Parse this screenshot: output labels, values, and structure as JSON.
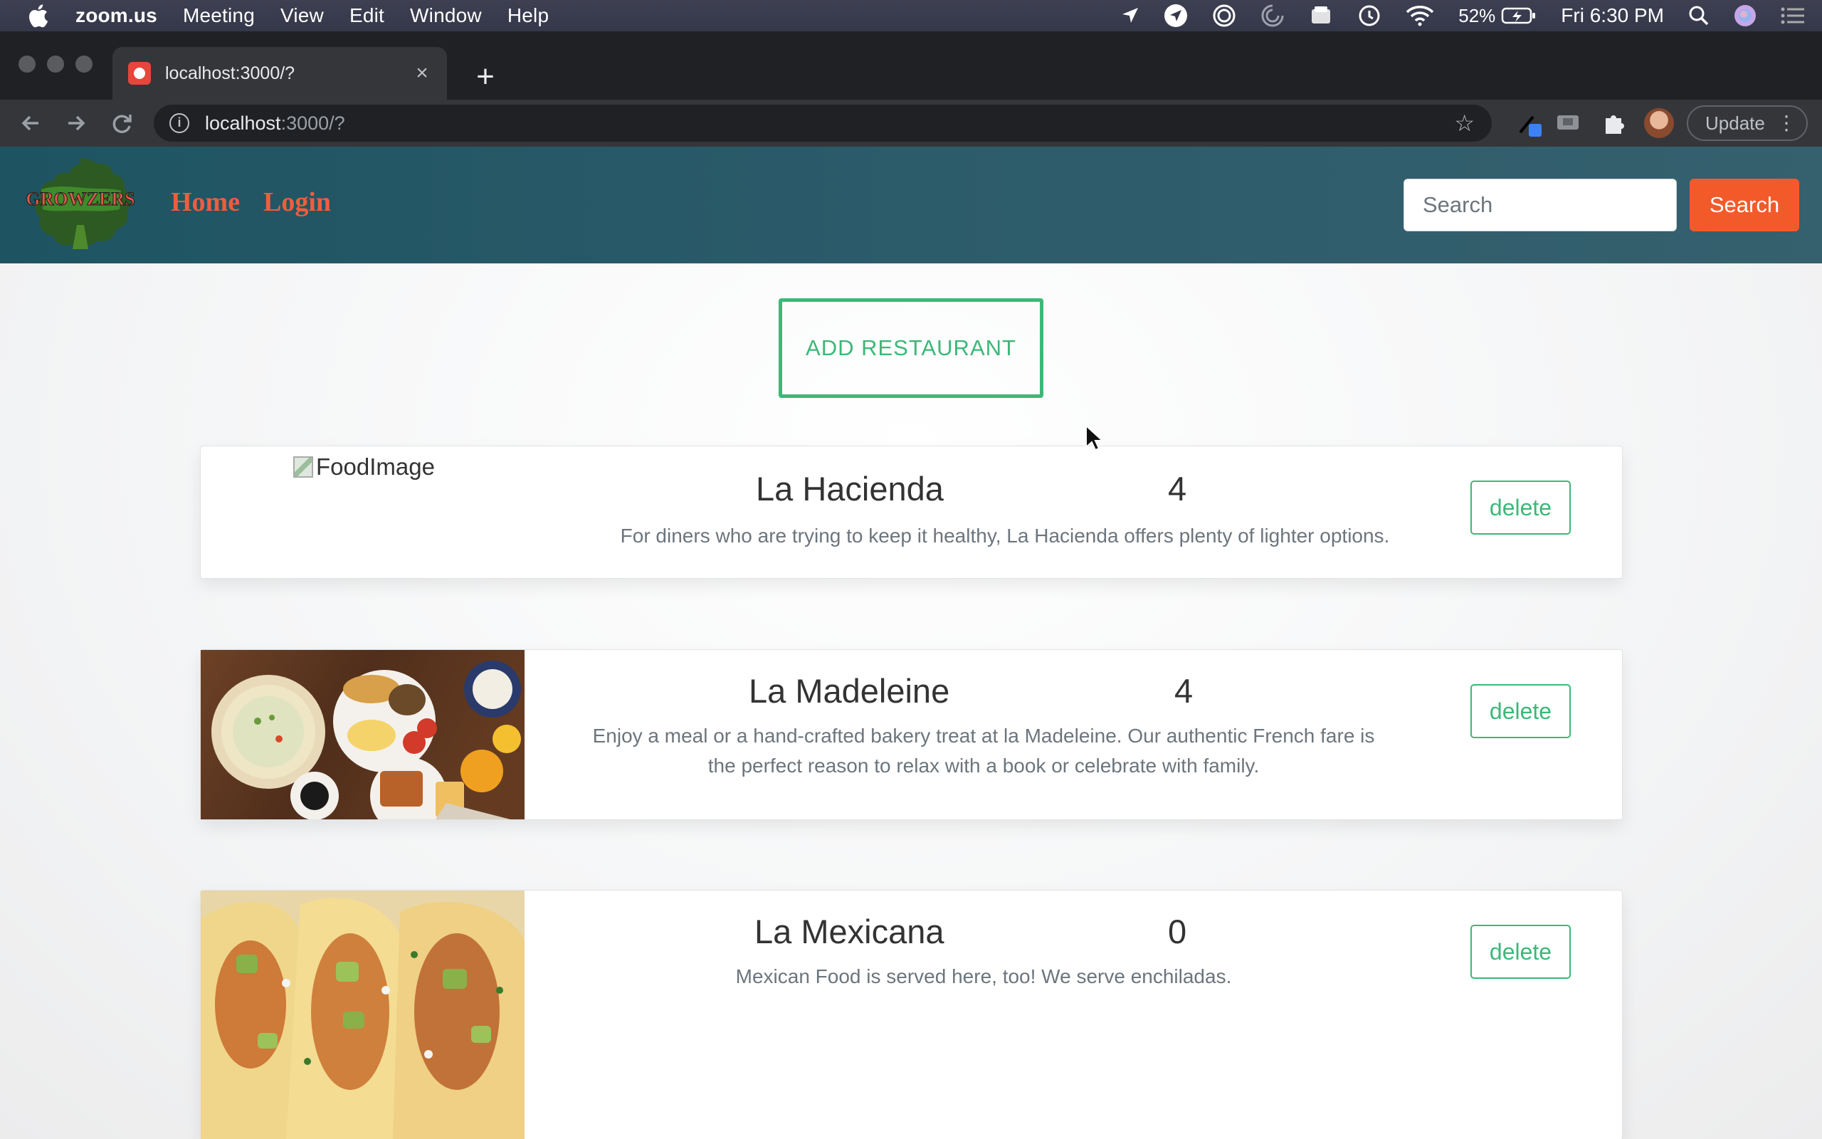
{
  "menubar": {
    "app": "zoom.us",
    "items": [
      "Meeting",
      "View",
      "Edit",
      "Window",
      "Help"
    ],
    "battery": "52%",
    "clock": "Fri 6:30 PM"
  },
  "browser": {
    "tab_title": "localhost:3000/?",
    "url_host": "localhost",
    "url_path": ":3000/?",
    "update_label": "Update"
  },
  "navbar": {
    "logo_text": "GROWZERS",
    "links": [
      "Home",
      "Login"
    ],
    "search_placeholder": "Search",
    "search_button": "Search"
  },
  "add_button": "ADD RESTAURANT",
  "restaurants": [
    {
      "name": "La Hacienda",
      "rating": "4",
      "image_alt": "FoodImage",
      "description": "For diners who are trying to keep it healthy, La Hacienda offers plenty of lighter options.",
      "delete_label": "delete"
    },
    {
      "name": "La Madeleine",
      "rating": "4",
      "description_line1": "Enjoy a meal or a hand-crafted bakery treat at la Madeleine. Our authentic French fare is",
      "description_line2": "the perfect reason to relax with a book or celebrate with family.",
      "delete_label": "delete"
    },
    {
      "name": "La Mexicana",
      "rating": "0",
      "description": "Mexican Food is served here, too! We serve enchiladas.",
      "delete_label": "delete"
    }
  ]
}
